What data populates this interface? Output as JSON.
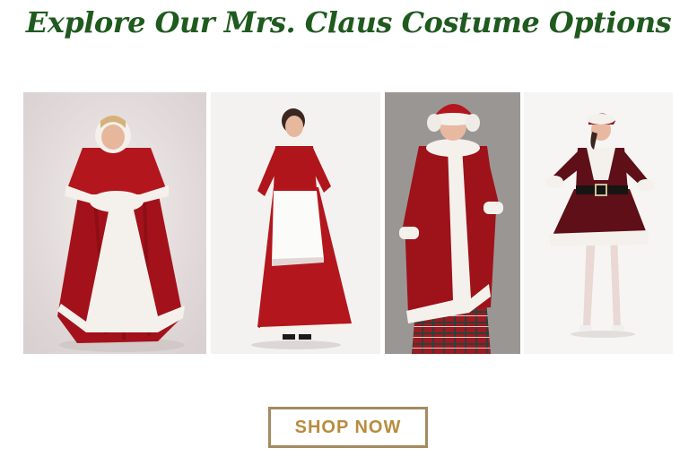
{
  "heading": "Explore Our Mrs. Claus Costume Options",
  "costumes": [
    {
      "icon": "mrs-claus-caped-gown-photo"
    },
    {
      "icon": "mrs-claus-apron-dress-photo"
    },
    {
      "icon": "mrs-claus-velvet-coat-photo"
    },
    {
      "icon": "mrs-claus-short-dress-photo"
    }
  ],
  "cta": {
    "label": "SHOP NOW"
  },
  "colors": {
    "heading": "#1f5a1f",
    "button_border": "#a58a5f",
    "button_text": "#b88c3e",
    "costume_red": "#b3161d",
    "fur_white": "#f4f1ec"
  }
}
